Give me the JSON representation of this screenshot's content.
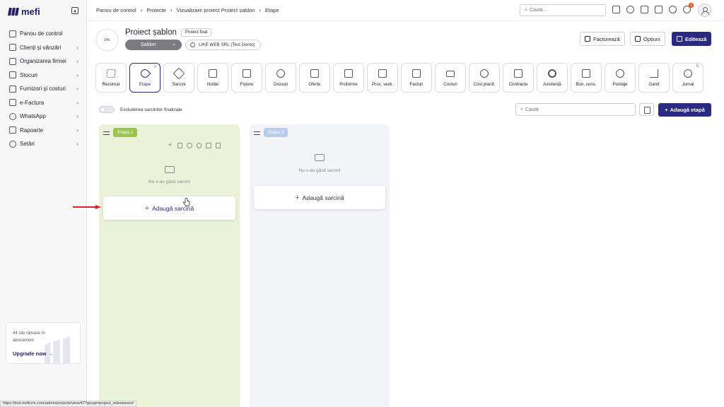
{
  "app": {
    "logo": "mefi"
  },
  "sidebar": {
    "items": [
      {
        "label": "Panou de control",
        "icon": "home-icon",
        "chevron": false
      },
      {
        "label": "Clienți și vânzări",
        "icon": "users-icon",
        "chevron": true
      },
      {
        "label": "Organizarea firmei",
        "icon": "grid-icon",
        "chevron": true
      },
      {
        "label": "Stocuri",
        "icon": "box-icon",
        "chevron": true
      },
      {
        "label": "Furnizori și costuri",
        "icon": "folder-icon",
        "chevron": true
      },
      {
        "label": "e-Factura",
        "icon": "efactura-icon",
        "chevron": true
      },
      {
        "label": "WhatsApp",
        "icon": "whatsapp-icon",
        "chevron": true
      },
      {
        "label": "Rapoarte",
        "icon": "clipboard-icon",
        "chevron": true
      },
      {
        "label": "Setări",
        "icon": "gear-icon",
        "chevron": true
      }
    ],
    "subscription": {
      "text": "44 zile rămase în abonament",
      "link": "Upgrade now"
    }
  },
  "topbar": {
    "breadcrumb": [
      "Panou de control",
      "Proiecte",
      "Vizualizare proiect Proiect șablon",
      "Etape"
    ],
    "search_placeholder": "Caută...",
    "notification_count": "1"
  },
  "project": {
    "progress": "0%",
    "title": "Proiect șablon",
    "badge": "Proiect fixat",
    "template_label": "Șablon",
    "client": "LIKE WEB SRL (Test Demo)",
    "actions": {
      "invoice": "Facturează",
      "options": "Opțiuni",
      "edit": "Editează"
    }
  },
  "tabs": [
    {
      "label": "Rezumat",
      "icon": "dots-grid-icon",
      "count": ""
    },
    {
      "label": "Etape",
      "icon": "rocket-icon",
      "count": "2",
      "active": true
    },
    {
      "label": "Sarcini",
      "icon": "layers-icon",
      "count": ""
    },
    {
      "label": "Notițe",
      "icon": "note-icon",
      "count": ""
    },
    {
      "label": "Fișiere",
      "icon": "file-icon",
      "count": ""
    },
    {
      "label": "Discuții",
      "icon": "chat-icon",
      "count": ""
    },
    {
      "label": "Oferte",
      "icon": "offer-icon",
      "count": ""
    },
    {
      "label": "Proforme",
      "icon": "proforma-icon",
      "count": ""
    },
    {
      "label": "Proc. verb.",
      "icon": "report-icon",
      "count": ""
    },
    {
      "label": "Facturi",
      "icon": "invoice-icon",
      "count": ""
    },
    {
      "label": "Costuri",
      "icon": "money-icon",
      "count": ""
    },
    {
      "label": "Cost planif.",
      "icon": "piggy-icon",
      "count": ""
    },
    {
      "label": "Contracte",
      "icon": "contract-icon",
      "count": ""
    },
    {
      "label": "Asistență",
      "icon": "lifebuoy-icon",
      "count": ""
    },
    {
      "label": "Bon. cons.",
      "icon": "receipt-icon",
      "count": ""
    },
    {
      "label": "Pontaje",
      "icon": "clock-icon",
      "count": ""
    },
    {
      "label": "Gantt",
      "icon": "gantt-icon",
      "count": ""
    },
    {
      "label": "Jurnal",
      "icon": "history-icon",
      "count": "6"
    }
  ],
  "toolbar": {
    "exclude_label": "Excluderea sarcinilor finalizate",
    "search_placeholder": "Caută",
    "add_stage": "Adaugă etapă"
  },
  "stages": [
    {
      "name": "Etapa 1",
      "empty_text": "Nu s-au găsit sarcini",
      "add_task": "Adaugă sarcină",
      "color": "#9bc64a"
    },
    {
      "name": "Etapa 2",
      "empty_text": "Nu s-au găsit sarcini",
      "add_task": "Adaugă sarcină",
      "color": "#b6cdee"
    }
  ],
  "status_url": "https://test.meficrm.com/admin/projects/view/47?group=project_milestones#",
  "colors": {
    "primary": "#2b2a82",
    "stage1_bg": "#eaf3d8",
    "stage2_bg": "#f3f4f8"
  }
}
